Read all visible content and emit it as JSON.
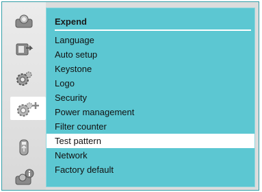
{
  "panel": {
    "title": "Expend"
  },
  "menu": {
    "items": [
      {
        "label": "Language"
      },
      {
        "label": "Auto setup"
      },
      {
        "label": "Keystone"
      },
      {
        "label": "Logo"
      },
      {
        "label": "Security"
      },
      {
        "label": "Power management"
      },
      {
        "label": "Filter counter"
      },
      {
        "label": "Test pattern"
      },
      {
        "label": "Network"
      },
      {
        "label": "Factory default"
      }
    ],
    "selected_index": 7
  },
  "sidebar": {
    "icons": [
      "projector-icon",
      "input-source-icon",
      "gear-settings-icon",
      "expand-settings-icon",
      "usb-memory-icon",
      "info-icon"
    ],
    "selected_icon": "expand-settings-icon"
  },
  "colors": {
    "panel_bg": "#5cc7d2",
    "highlight": "#ffffff",
    "frame": "#2f9ca6"
  }
}
